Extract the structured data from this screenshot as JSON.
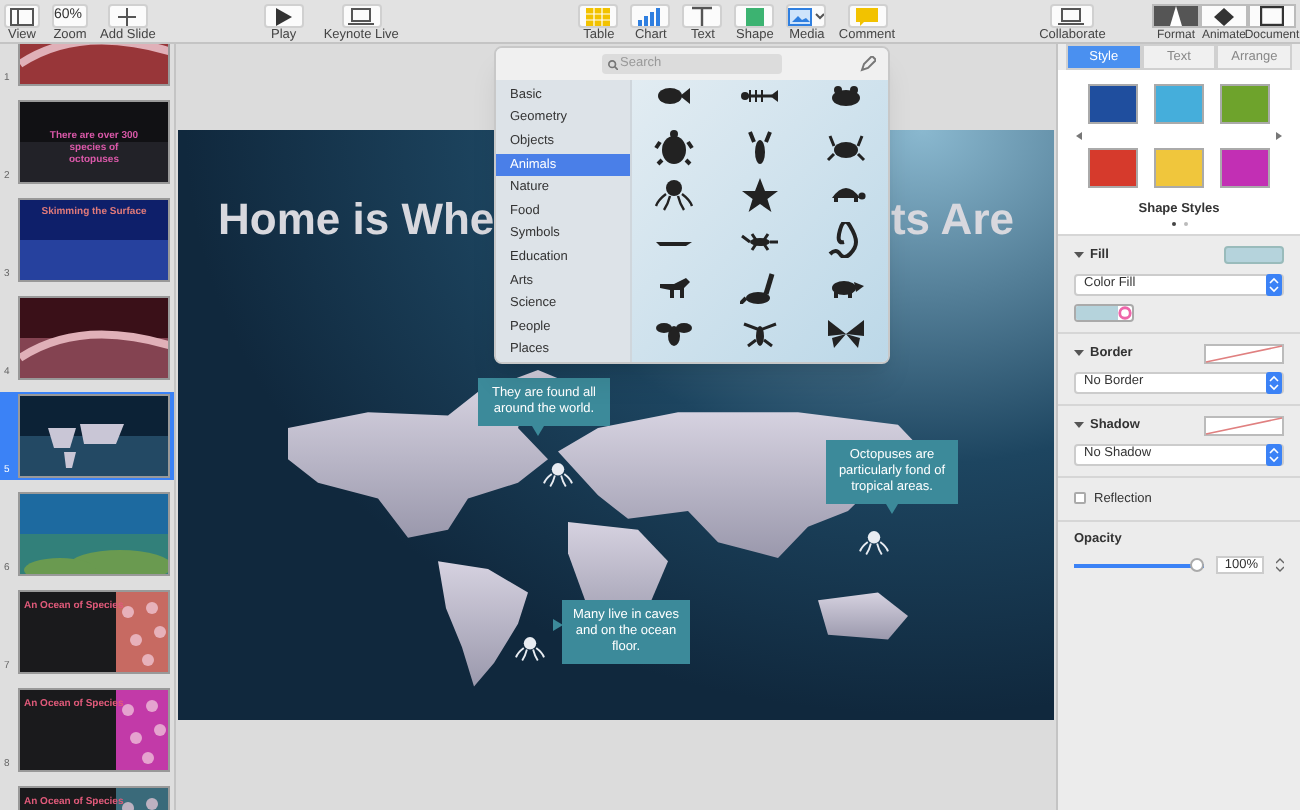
{
  "toolbar": {
    "left": [
      {
        "kind": "view",
        "label": "View"
      },
      {
        "kind": "zoom",
        "label": "Zoom",
        "value": "60%"
      },
      {
        "kind": "add",
        "label": "Add Slide"
      }
    ],
    "play": [
      {
        "kind": "play",
        "label": "Play"
      },
      {
        "kind": "live",
        "label": "Keynote Live"
      }
    ],
    "insert": [
      {
        "kind": "table",
        "label": "Table"
      },
      {
        "kind": "chart",
        "label": "Chart"
      },
      {
        "kind": "text",
        "label": "Text"
      },
      {
        "kind": "shape",
        "label": "Shape"
      },
      {
        "kind": "media",
        "label": "Media"
      },
      {
        "kind": "comment",
        "label": "Comment"
      }
    ],
    "collaborate": {
      "label": "Collaborate"
    },
    "inspectors": [
      {
        "kind": "format",
        "label": "Format",
        "selected": true
      },
      {
        "kind": "animate",
        "label": "Animate",
        "selected": false
      },
      {
        "kind": "document",
        "label": "Document",
        "selected": false
      }
    ]
  },
  "slides": [
    {
      "number": "1",
      "selected": false
    },
    {
      "number": "2",
      "title": "There are over 300 species of octopuses",
      "selected": false
    },
    {
      "number": "3",
      "title": "Skimming the Surface",
      "selected": false
    },
    {
      "number": "4",
      "selected": false
    },
    {
      "number": "5",
      "selected": true
    },
    {
      "number": "6",
      "selected": false
    },
    {
      "number": "7",
      "title": "An Ocean of Species",
      "selected": false
    },
    {
      "number": "8",
      "title": "An Ocean of Species",
      "selected": false
    },
    {
      "title": "An Ocean of Species",
      "selected": false
    }
  ],
  "slide": {
    "title_left": "Home is Whe",
    "title_right": "ts Are",
    "callouts": [
      {
        "text": "They are found all around the world."
      },
      {
        "text": "Octopuses are particularly fond of tropical areas."
      },
      {
        "text": "Many live in caves and on the ocean floor."
      }
    ]
  },
  "shape_library": {
    "search": {
      "placeholder": "Search"
    },
    "categories": [
      {
        "label": "Basic",
        "selected": false
      },
      {
        "label": "Geometry",
        "selected": false
      },
      {
        "label": "Objects",
        "selected": false
      },
      {
        "label": "Animals",
        "selected": true
      },
      {
        "label": "Nature",
        "selected": false
      },
      {
        "label": "Food",
        "selected": false
      },
      {
        "label": "Symbols",
        "selected": false
      },
      {
        "label": "Education",
        "selected": false
      },
      {
        "label": "Arts",
        "selected": false
      },
      {
        "label": "Science",
        "selected": false
      },
      {
        "label": "People",
        "selected": false
      },
      {
        "label": "Places",
        "selected": false
      }
    ]
  },
  "inspector": {
    "tabs": [
      {
        "label": "Style",
        "selected": true
      },
      {
        "label": "Text",
        "selected": false
      },
      {
        "label": "Arrange",
        "selected": false
      }
    ],
    "styles": [
      {
        "color": "#1f4e9e"
      },
      {
        "color": "#45aedb"
      },
      {
        "color": "#6ea32c"
      },
      {
        "color": "#d63a2c"
      },
      {
        "color": "#f0c63c"
      },
      {
        "color": "#c22fb4"
      }
    ],
    "styles_label": "Shape Styles",
    "fill": {
      "label": "Fill",
      "expanded": true,
      "value": "Color Fill",
      "color": "#b5d3dc"
    },
    "border": {
      "label": "Border",
      "expanded": true,
      "value": "No Border"
    },
    "shadow": {
      "label": "Shadow",
      "expanded": true,
      "value": "No Shadow"
    },
    "reflection": {
      "label": "Reflection",
      "checked": false
    },
    "opacity": {
      "label": "Opacity",
      "level": 1,
      "reading": "100%"
    }
  }
}
